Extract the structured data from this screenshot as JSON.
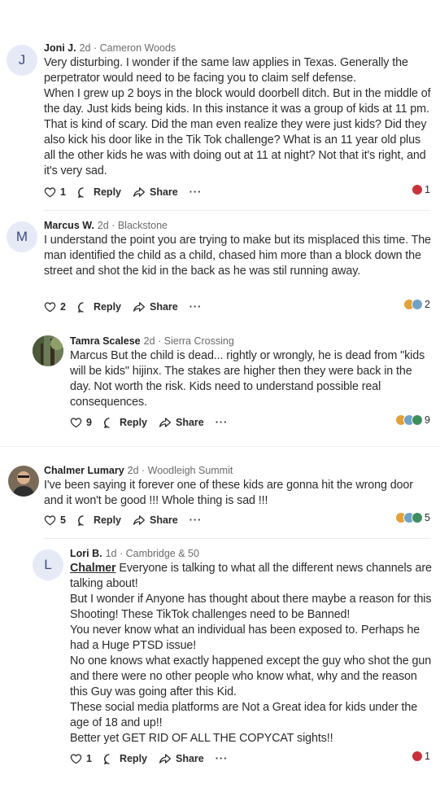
{
  "comments": [
    {
      "author": "Joni J.",
      "meta": "2d · Cameron Woods",
      "avatar_letter": "J",
      "body": [
        "Very disturbing. I wonder if the same law applies in Texas. Generally the perpetrator would need to be facing you to claim self defense.",
        "When I grew up 2 boys in the block would doorbell ditch. But in the middle of the day. Just kids being kids. In this instance it was a group of kids at 11 pm. That is kind of scary. Did the man even realize they were just kids? Did they also kick his door like in the Tik Tok challenge? What is an 11 year old plus all the other kids he was with doing out at 11 at night? Not that it's right, and it's very sad."
      ],
      "like_count": "1",
      "reply_label": "Reply",
      "share_label": "Share",
      "more_label": "···",
      "reaction_count": "1"
    },
    {
      "author": "Marcus W.",
      "meta": "2d · Blackstone",
      "avatar_letter": "M",
      "body": [
        "I understand the point you are trying to make but its misplaced this time. The man identified the child as a child, chased him more than a block down the street and shot the kid in the back as he was stil running away."
      ],
      "like_count": "2",
      "reply_label": "Reply",
      "share_label": "Share",
      "more_label": "···",
      "reaction_count": "2"
    },
    {
      "author": "Tamra Scalese",
      "meta": "2d · Sierra Crossing",
      "body": [
        "Marcus But the child is dead... rightly or wrongly, he is dead from \"kids will be kids\" hijinx. The stakes are higher then they were back in the day. Not worth the risk. Kids need to understand possible real consequences."
      ],
      "like_count": "9",
      "reply_label": "Reply",
      "share_label": "Share",
      "more_label": "···",
      "reaction_count": "9"
    },
    {
      "author": "Chalmer Lumary",
      "meta": "2d · Woodleigh Summit",
      "body": [
        "I've been saying it forever one of these kids are gonna hit the wrong door and it won't be good !!! Whole thing is sad !!!"
      ],
      "like_count": "5",
      "reply_label": "Reply",
      "share_label": "Share",
      "more_label": "···",
      "reaction_count": "5"
    },
    {
      "author": "Lori B.",
      "meta": "1d · Cambridge & 50",
      "avatar_letter": "L",
      "mention": "Chalmer",
      "body_first": " Everyone is talking to what all the different news channels are talking about!",
      "body": [
        "But I wonder if Anyone has thought about there maybe a reason for this Shooting! These TikTok challenges need to be Banned!",
        "You never know what an individual has been exposed to. Perhaps he had a Huge PTSD issue!",
        "No one knows what exactly happened except the guy who shot the gun and there were no other people who know what, why and the reason this Guy was going after this Kid.",
        "These social media platforms are Not a Great idea for kids under the age of 18 and up!!",
        "Better yet GET RID OF ALL THE COPYCAT sights!!"
      ],
      "like_count": "1",
      "reply_label": "Reply",
      "share_label": "Share",
      "more_label": "···",
      "reaction_count": "1"
    }
  ],
  "colors": {
    "heart_reaction": "#c8323c",
    "avatar_bg": "#e6eaf7",
    "avatar_text": "#3d4a7a",
    "meta_text": "#6b6b6b"
  },
  "icons": [
    "heart-outline-icon",
    "reply-bubble-icon",
    "share-arrow-icon",
    "more-dots-icon",
    "reaction-icons"
  ]
}
